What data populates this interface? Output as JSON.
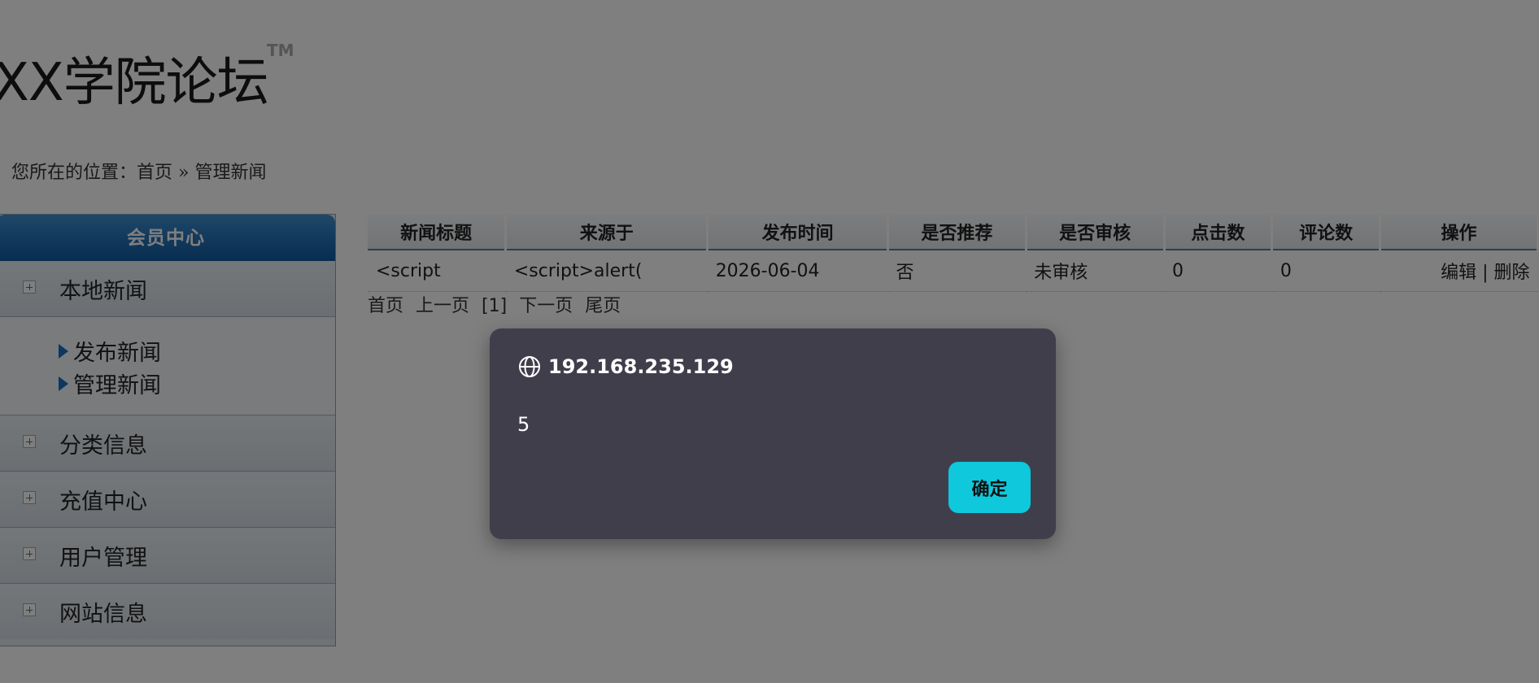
{
  "header": {
    "logo_text": "XX学院论坛",
    "trademark": "TM"
  },
  "breadcrumb": {
    "prefix": "您所在的位置：",
    "home": "首页",
    "sep": " » ",
    "current": "管理新闻"
  },
  "sidebar": {
    "title": "会员中心",
    "groups": [
      {
        "label": "本地新闻"
      },
      {
        "label": "分类信息"
      },
      {
        "label": "充值中心"
      },
      {
        "label": "用户管理"
      },
      {
        "label": "网站信息"
      }
    ],
    "subitems": [
      {
        "label": "发布新闻"
      },
      {
        "label": "管理新闻"
      }
    ]
  },
  "table": {
    "headers": [
      "新闻标题",
      "来源于",
      "发布时间",
      "是否推荐",
      "是否审核",
      "点击数",
      "评论数",
      "操作"
    ],
    "rows": [
      {
        "title": "<script",
        "source": "<script>alert(",
        "date": "2026-06-04",
        "recommend": "否",
        "audit": "未审核",
        "clicks": "0",
        "comments": "0",
        "edit": "编辑",
        "op_sep": " | ",
        "delete": "删除"
      }
    ]
  },
  "pager": {
    "first": "首页",
    "prev": "上一页",
    "current": "[1]",
    "next": "下一页",
    "last": "尾页"
  },
  "dialog": {
    "title": "192.168.235.129",
    "message": "5",
    "ok_label": "确定"
  },
  "colors": {
    "dialog_bg": "#413e4c",
    "ok_button": "#0fc8dc",
    "sidebar_header": "#0f5aa0"
  }
}
